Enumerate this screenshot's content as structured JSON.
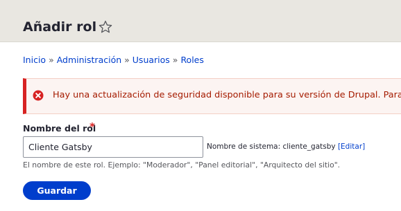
{
  "page": {
    "title": "Añadir rol",
    "favorite_icon": "star-outline-icon"
  },
  "breadcrumb": {
    "items": [
      "Inicio",
      "Administración",
      "Usuarios",
      "Roles"
    ],
    "separator": "»"
  },
  "messages": {
    "error_icon": "error-circle-x-icon",
    "error_text": "Hay una actualización de seguridad disponible para su versión de Drupal. Para g",
    "colors": {
      "text": "#a51b00",
      "accent": "#d72222",
      "background": "#fcf4f2"
    }
  },
  "form": {
    "role_name": {
      "label": "Nombre del rol",
      "required_mark": "*",
      "value": "Cliente Gatsby",
      "machine_name_label": "Nombre de sistema: cliente_gatsby",
      "edit_link": "[Editar]",
      "description": "El nombre de este rol. Ejemplo: \"Moderador\", \"Panel editorial\", \"Arquitecto del sitio\"."
    },
    "submit_label": "Guardar"
  },
  "theme": {
    "link_color": "#003ecc",
    "primary_button": "#003ecc",
    "header_background": "#e9e7e1"
  }
}
